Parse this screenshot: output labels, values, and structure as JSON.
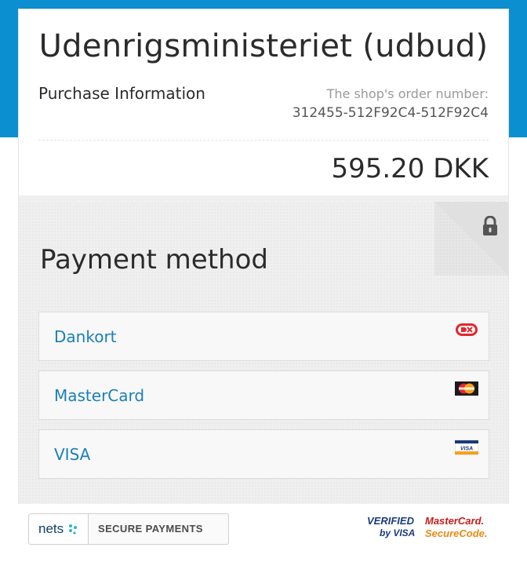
{
  "header": {
    "shop_name": "Udenrigsministeriet (udbud)",
    "purchase_info_label": "Purchase Information",
    "order_number_label": "The shop's order number:",
    "order_number": "312455-512F92C4-512F92C4",
    "amount": "595.20 DKK"
  },
  "payment": {
    "title": "Payment method",
    "methods": [
      {
        "label": "Dankort",
        "logo": "dankort-logo"
      },
      {
        "label": "MasterCard",
        "logo": "mastercard-logo"
      },
      {
        "label": "VISA",
        "logo": "visa-logo"
      }
    ]
  },
  "footer": {
    "nets_brand": "nets",
    "secure_label": "SECURE PAYMENTS",
    "vbv_line1": "VERIFIED",
    "vbv_line2": "by VISA",
    "mcsc_line1": "MasterCard.",
    "mcsc_line2": "SecureCode."
  },
  "colors": {
    "top_band": "#0b8fd0",
    "link": "#1a7fb8",
    "pay_area_bg": "#efefef"
  }
}
